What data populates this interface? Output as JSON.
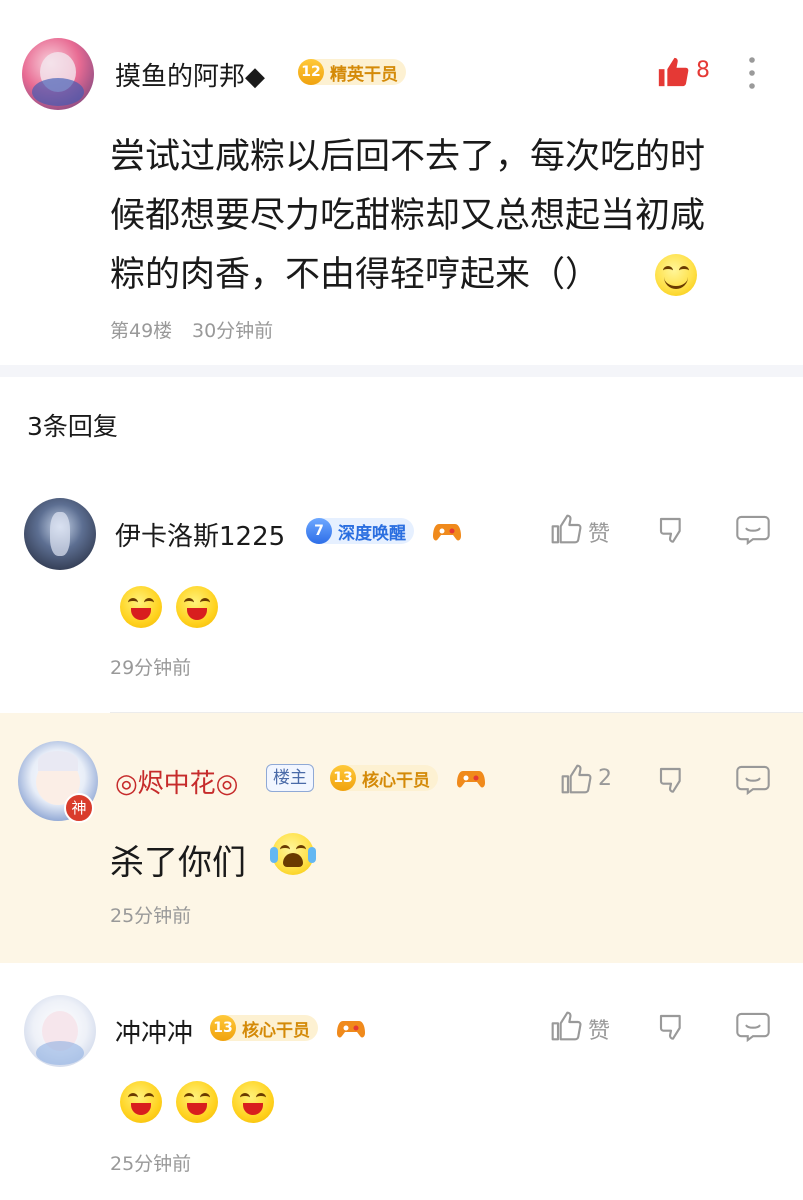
{
  "post": {
    "author": "摸鱼的阿邦◆",
    "level": "12",
    "level_title": "精英干员",
    "like_count": "8",
    "content_lines": [
      "尝试过咸粽以后回不去了，每次吃的时",
      "候都想要尽力吃甜粽却又总想起当初咸",
      "粽的肉香，不由得轻哼起来（）"
    ],
    "floor": "第49楼",
    "time": "30分钟前"
  },
  "replies_header": "3条回复",
  "replies": [
    {
      "author": "伊卡洛斯1225",
      "level": "7",
      "level_title": "深度唤醒",
      "like_label": "赞",
      "emoji_count": 2,
      "time": "29分钟前"
    },
    {
      "author": "◎烬中花◎",
      "host_tag": "楼主",
      "level": "13",
      "level_title": "核心干员",
      "like_label": "2",
      "content": "杀了你们",
      "time": "25分钟前",
      "avatar_badge": "神"
    },
    {
      "author": "冲冲冲",
      "level": "13",
      "level_title": "核心干员",
      "like_label": "赞",
      "emoji_count": 3,
      "time": "25分钟前"
    }
  ],
  "colors": {
    "like_red": "#e53935",
    "host_bg": "#fdf6e6",
    "gold_badge": "#f0a20e",
    "blue_badge": "#2d6ee8"
  },
  "icons": [
    "thumbs-up-icon",
    "more-vertical-icon",
    "grin-emoji-icon",
    "crying-laugh-emoji-icon",
    "dislike-icon",
    "comment-icon",
    "gamepad-icon"
  ]
}
